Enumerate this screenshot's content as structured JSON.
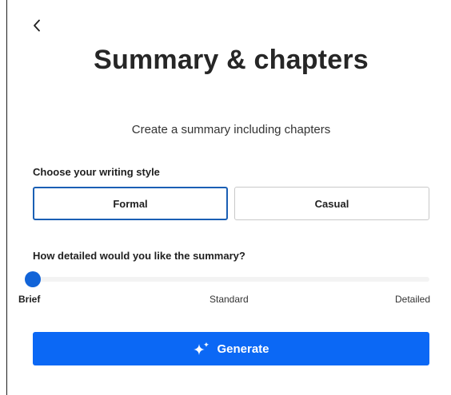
{
  "header": {
    "back_icon": "chevron-left-icon",
    "title": "Summary & chapters",
    "subtitle": "Create a summary including chapters"
  },
  "writing_style": {
    "label": "Choose your writing style",
    "options": [
      {
        "label": "Formal",
        "selected": true
      },
      {
        "label": "Casual",
        "selected": false
      }
    ]
  },
  "detail": {
    "label": "How detailed would you like the summary?",
    "levels": [
      "Brief",
      "Standard",
      "Detailed"
    ],
    "selected_level": "Brief"
  },
  "generate": {
    "label": "Generate",
    "icon": "sparkle-icon"
  },
  "colors": {
    "accent": "#0b68f5",
    "selected_border": "#1a5fb4",
    "thumb": "#1264d8"
  }
}
